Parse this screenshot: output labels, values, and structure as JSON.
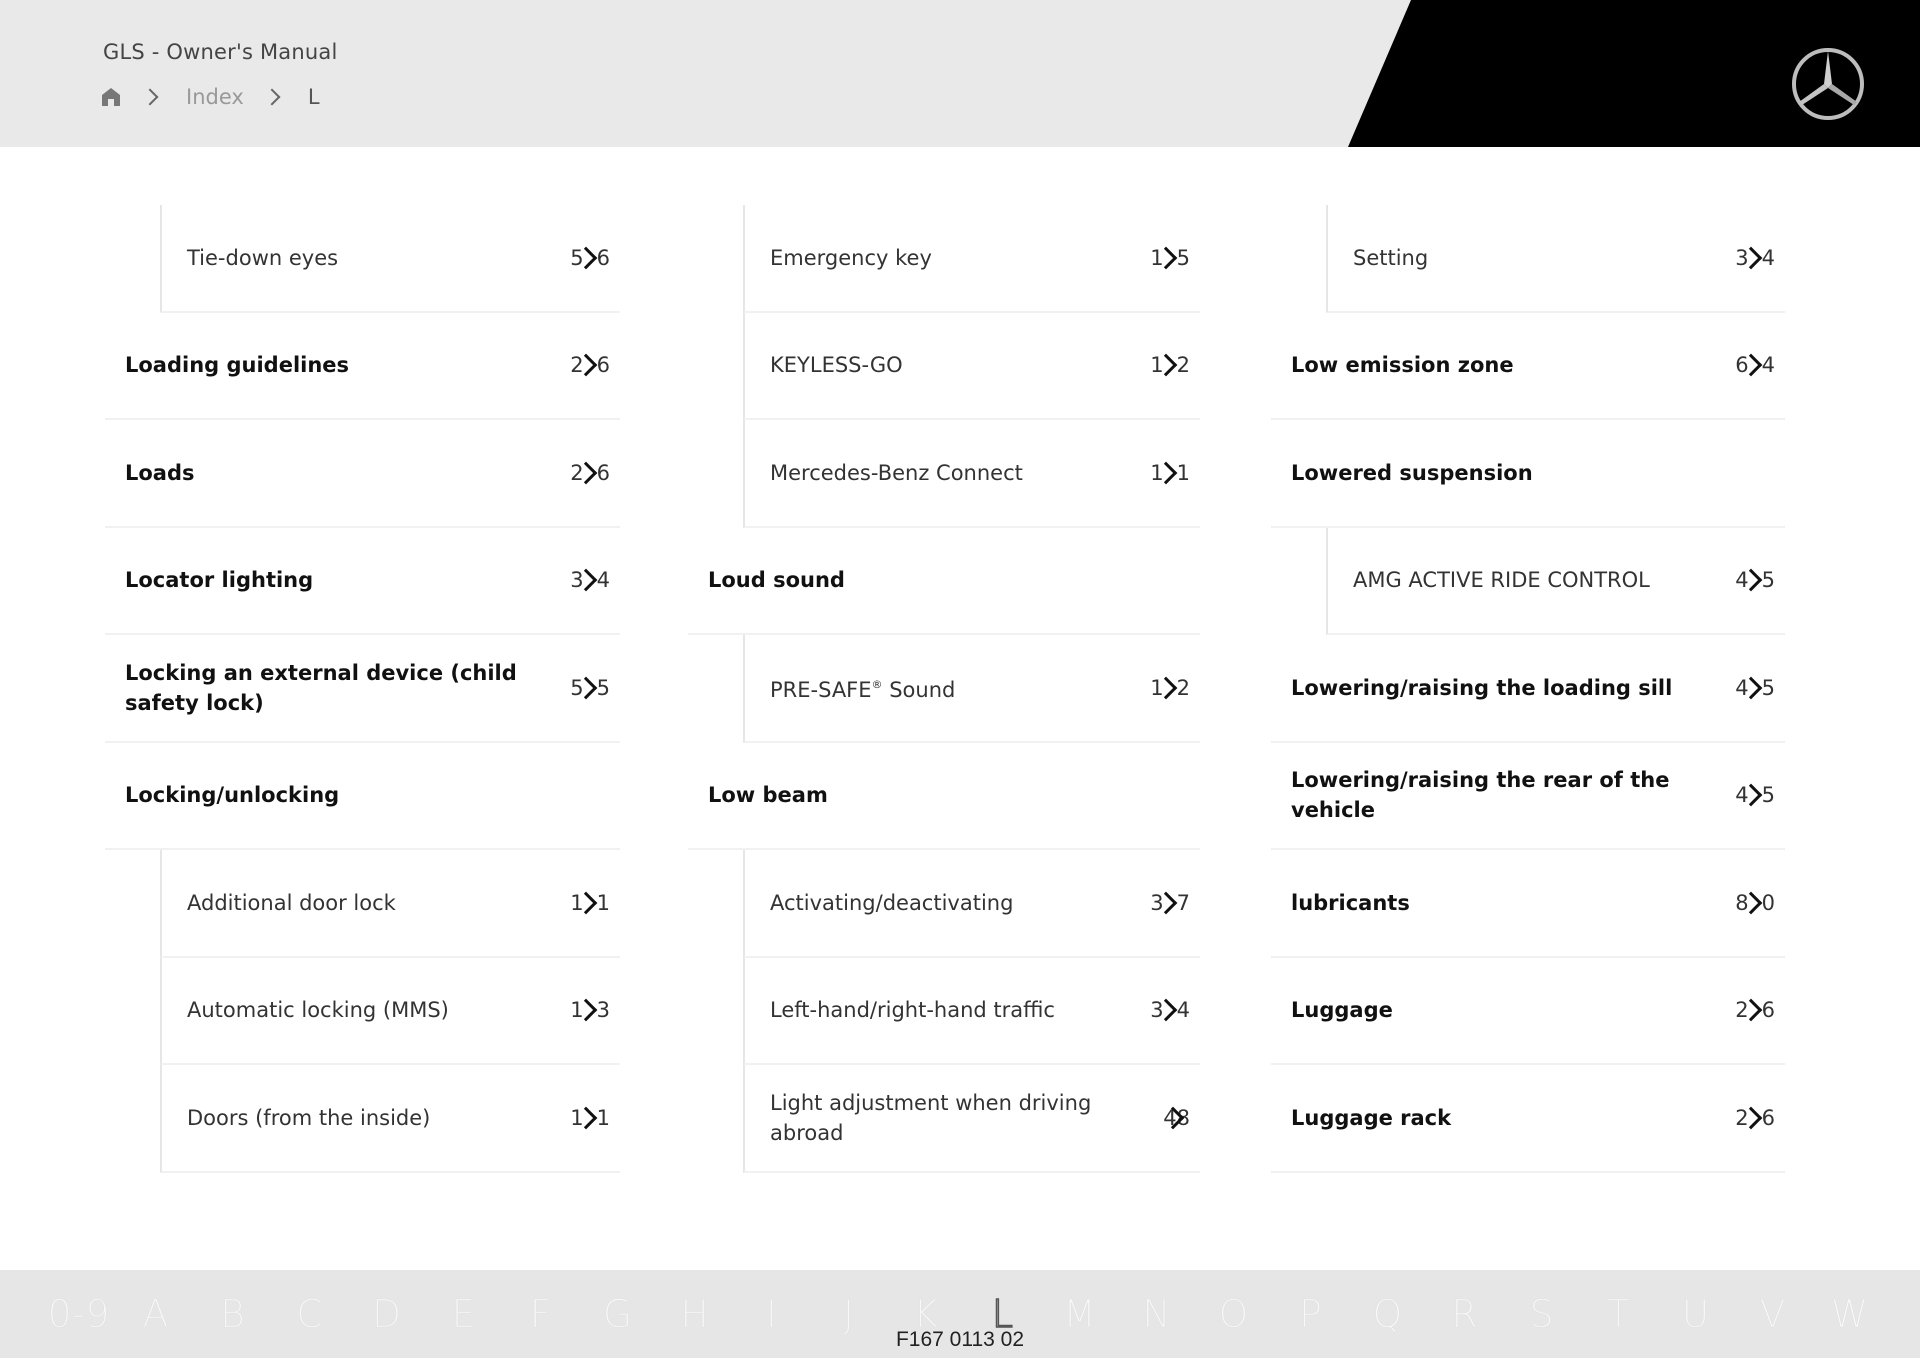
{
  "header": {
    "title": "GLS - Owner's Manual",
    "breadcrumb": [
      {
        "label": "Home",
        "icon": "home-icon"
      },
      {
        "label": "Index"
      },
      {
        "label": "L"
      }
    ],
    "logo": "mercedes-star-logo",
    "colors": {
      "header_bg": "#e9e9e9",
      "brand_panel": "#000000"
    }
  },
  "columns": [
    {
      "rows": [
        {
          "type": "sub",
          "label": "Tie-down eyes",
          "page": [
            "5",
            "6"
          ]
        },
        {
          "type": "top",
          "label": "Loading guidelines",
          "page": [
            "2",
            "6"
          ]
        },
        {
          "type": "top",
          "label": "Loads",
          "page": [
            "2",
            "6"
          ]
        },
        {
          "type": "top",
          "label": "Locator lighting",
          "page": [
            "3",
            "4"
          ]
        },
        {
          "type": "top",
          "label": "Locking an external device (child safety lock)",
          "page": [
            "5",
            "5"
          ]
        },
        {
          "type": "top",
          "label": "Locking/unlocking",
          "page": null
        },
        {
          "type": "sub",
          "label": "Additional door lock",
          "page": [
            "1",
            "1"
          ]
        },
        {
          "type": "sub",
          "label": "Automatic locking (MMS)",
          "page": [
            "1",
            "3"
          ]
        },
        {
          "type": "sub",
          "label": "Doors (from the inside)",
          "page": [
            "1",
            "1"
          ]
        }
      ]
    },
    {
      "rows": [
        {
          "type": "sub",
          "label": "Emergency key",
          "page": [
            "1",
            "5"
          ]
        },
        {
          "type": "sub",
          "label": "KEYLESS-GO",
          "page": [
            "1",
            "2"
          ]
        },
        {
          "type": "sub",
          "label": "Mercedes-Benz Connect",
          "page": [
            "1",
            "1"
          ]
        },
        {
          "type": "top",
          "label": "Loud sound",
          "page": null
        },
        {
          "type": "sub",
          "label": "PRE-SAFE",
          "label_sup": "®",
          "label_suffix": " Sound",
          "page": [
            "1",
            "2"
          ]
        },
        {
          "type": "top",
          "label": "Low beam",
          "page": null
        },
        {
          "type": "sub",
          "label": "Activating/deactivating",
          "page": [
            "3",
            "7"
          ]
        },
        {
          "type": "sub",
          "label": "Left-hand/right-hand traffic",
          "page": [
            "3",
            "4"
          ]
        },
        {
          "type": "sub",
          "label": "Light adjustment when driving abroad",
          "page": [
            "4",
            "8"
          ],
          "two_digit": true
        }
      ]
    },
    {
      "rows": [
        {
          "type": "sub",
          "label": "Setting",
          "page": [
            "3",
            "4"
          ]
        },
        {
          "type": "top",
          "label": "Low emission zone",
          "page": [
            "6",
            "4"
          ]
        },
        {
          "type": "top",
          "label": "Lowered suspension",
          "page": null
        },
        {
          "type": "sub",
          "label": "AMG ACTIVE RIDE CONTROL",
          "page": [
            "4",
            "5"
          ]
        },
        {
          "type": "top",
          "label": "Lowering/raising the loading sill",
          "page": [
            "4",
            "5"
          ]
        },
        {
          "type": "top",
          "label": "Lowering/raising the rear of the vehicle",
          "page": [
            "4",
            "5"
          ]
        },
        {
          "type": "top",
          "label": "lubricants",
          "page": [
            "8",
            "0"
          ]
        },
        {
          "type": "top",
          "label": "Luggage",
          "page": [
            "2",
            "6"
          ]
        },
        {
          "type": "top",
          "label": "Luggage rack",
          "page": [
            "2",
            "6"
          ]
        }
      ]
    }
  ],
  "footer": {
    "letters": [
      "0-9",
      "A",
      "B",
      "C",
      "D",
      "E",
      "F",
      "G",
      "H",
      "I",
      "J",
      "K",
      "L",
      "M",
      "N",
      "O",
      "P",
      "Q",
      "R",
      "S",
      "T",
      "U",
      "V",
      "W"
    ],
    "active_letter": "L",
    "code": "F167 0113 02"
  }
}
